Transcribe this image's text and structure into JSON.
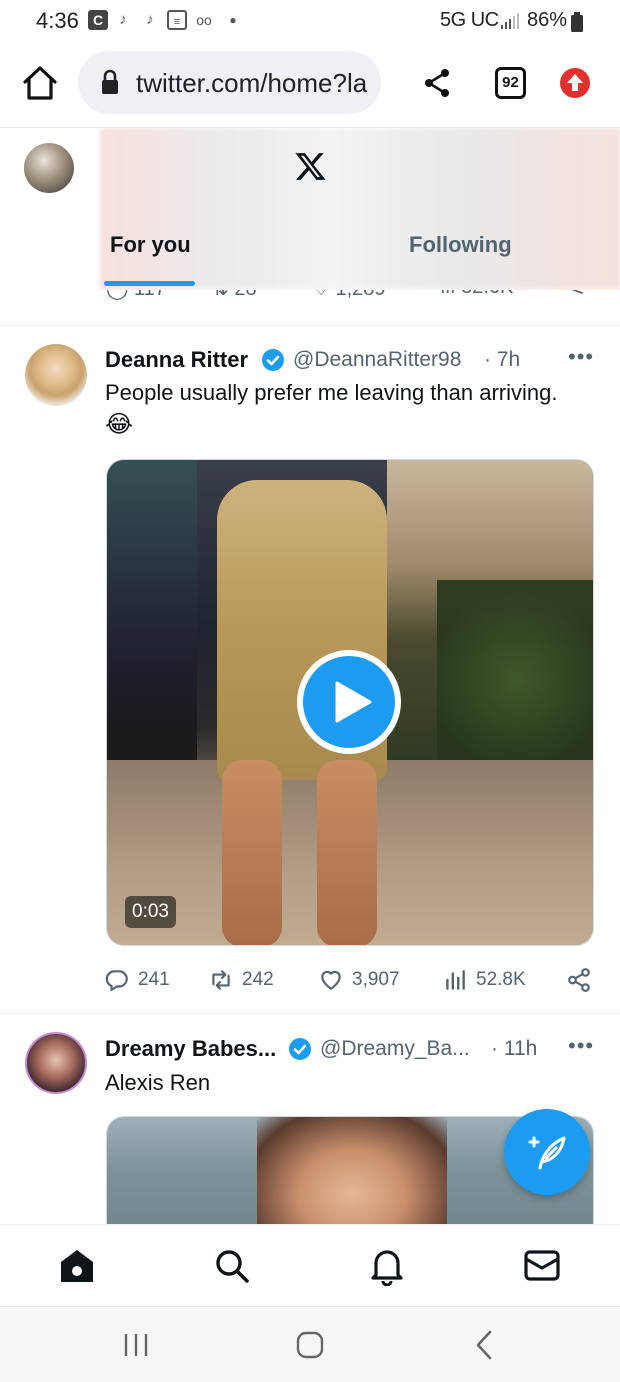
{
  "status_bar": {
    "time": "4:36",
    "notification_icons": [
      "c-app-icon",
      "tiktok-icon",
      "tiktok-icon",
      "news-icon",
      "voicemail-icon",
      "dot-icon"
    ],
    "network": "5G UC",
    "battery": "86%"
  },
  "browser": {
    "url": "twitter.com/home?la",
    "tab_count": "92"
  },
  "header": {
    "logo": "X",
    "tabs": [
      {
        "label": "For you",
        "active": true
      },
      {
        "label": "Following",
        "active": false
      }
    ]
  },
  "previous_tweet_actions": {
    "replies": "117",
    "retweets": "28",
    "likes": "1,289",
    "views": "32.6K"
  },
  "tweets": [
    {
      "name": "Deanna Ritter",
      "handle": "@DeannaRitter98",
      "time": "· 7h",
      "text": "People usually prefer me leaving than arriving.",
      "emoji": "😂",
      "video_duration": "0:03",
      "replies": "241",
      "retweets": "242",
      "likes": "3,907",
      "views": "52.8K"
    },
    {
      "name": "Dreamy Babes...",
      "handle": "@Dreamy_Ba...",
      "time": "· 11h",
      "text": "Alexis Ren"
    }
  ],
  "colors": {
    "accent": "#1d9bf0",
    "text_primary": "#0f1419",
    "text_secondary": "#536471"
  }
}
